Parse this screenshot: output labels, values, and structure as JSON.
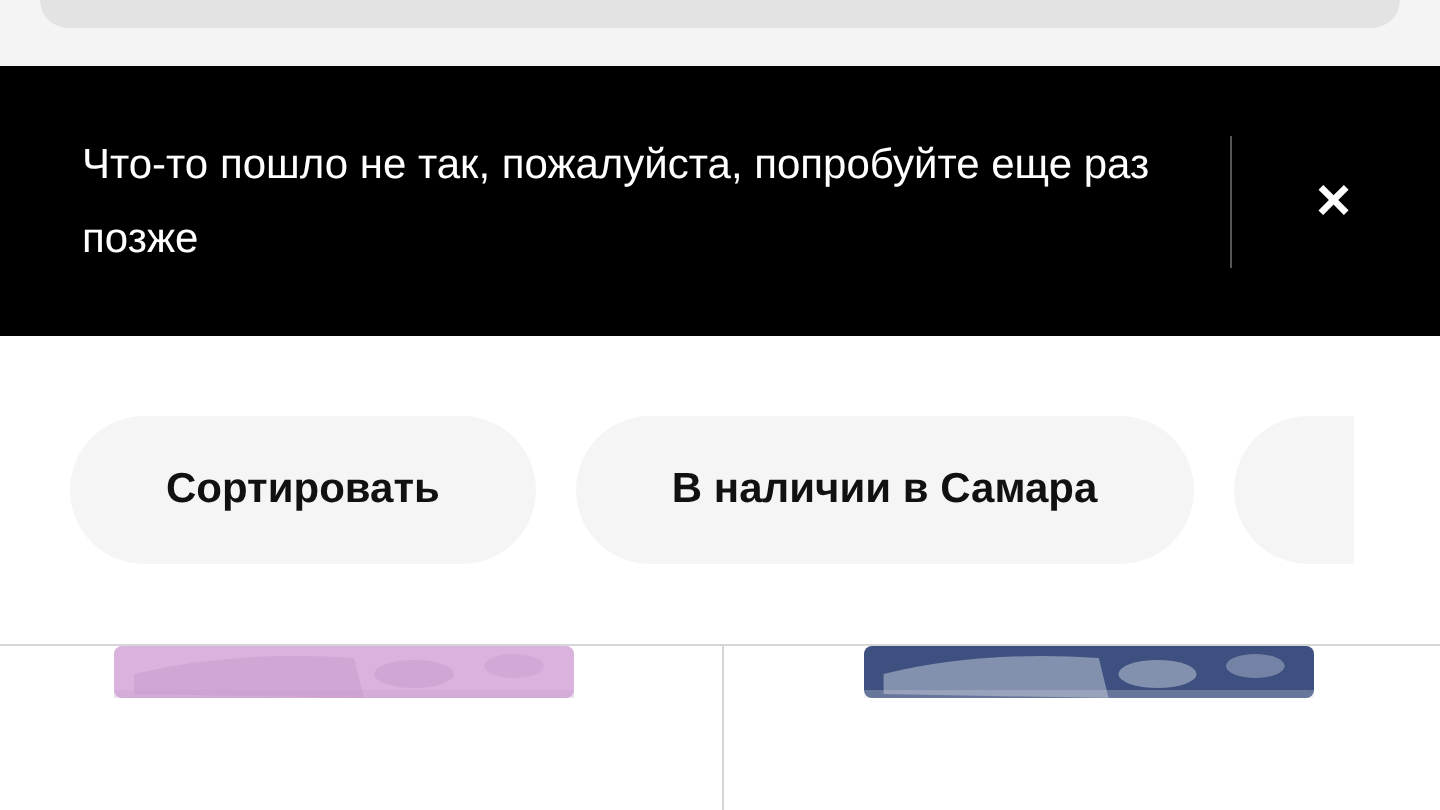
{
  "error_banner": {
    "message": "Что-то пошло не так, пожалуйста, попробуйте еще раз позже",
    "close": "×"
  },
  "filters": [
    {
      "label": "Сортировать"
    },
    {
      "label": "В наличии в Самара"
    }
  ]
}
